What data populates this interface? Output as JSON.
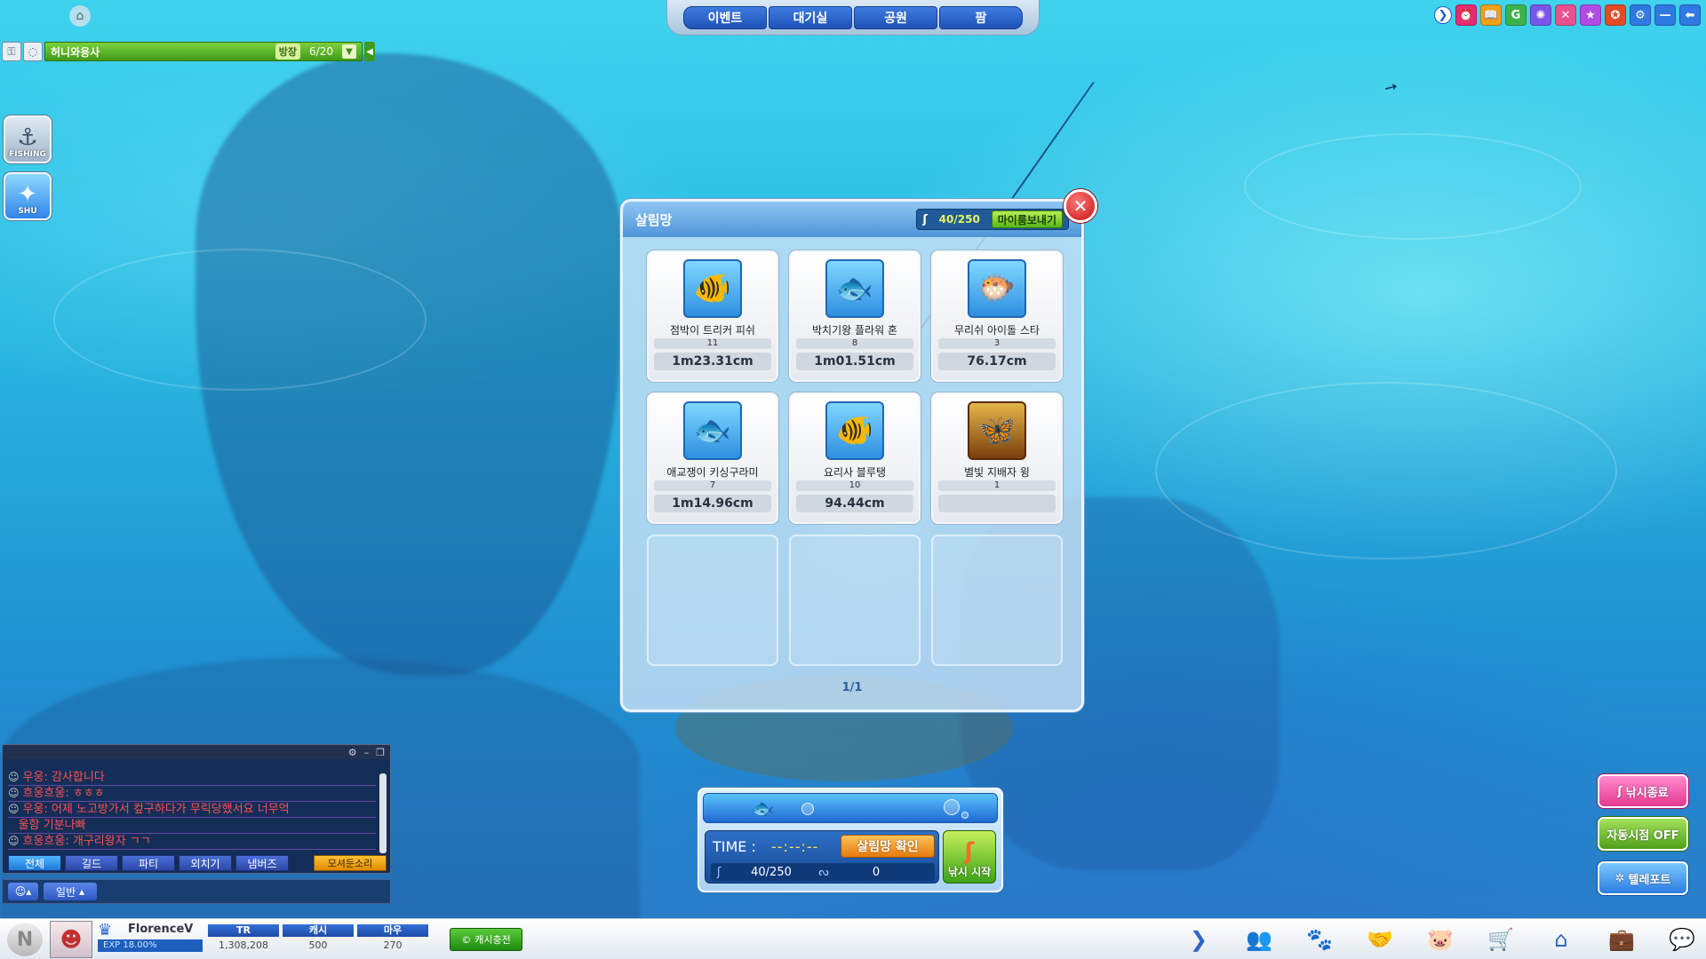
{
  "top_nav": {
    "tabs": [
      {
        "label": "이벤트"
      },
      {
        "label": "대기실"
      },
      {
        "label": "공원"
      },
      {
        "label": "팜"
      }
    ]
  },
  "top_icons": [
    {
      "icon": "arrow-right-icon",
      "glyph": "❯",
      "color": "#ffffff"
    },
    {
      "icon": "alarm-icon",
      "glyph": "⏰",
      "color": "#e52a73"
    },
    {
      "icon": "story-book-icon",
      "glyph": "📖",
      "color": "#f0a11c"
    },
    {
      "icon": "g-coin-icon",
      "glyph": "G",
      "color": "#3bb34a"
    },
    {
      "icon": "settings-star-icon",
      "glyph": "✺",
      "color": "#7b56e8"
    },
    {
      "icon": "crossed-tools-icon",
      "glyph": "✕",
      "color": "#e8508e"
    },
    {
      "icon": "event-star-icon",
      "glyph": "★",
      "color": "#b04be6"
    },
    {
      "icon": "book-icon",
      "glyph": "✪",
      "color": "#e24b25"
    },
    {
      "icon": "gear-icon",
      "glyph": "⚙",
      "color": "#2f79e3"
    },
    {
      "icon": "minimize-icon",
      "glyph": "—",
      "color": "#2f79e3"
    },
    {
      "icon": "back-arrow-icon",
      "glyph": "⬅",
      "color": "#2f79e3"
    }
  ],
  "room": {
    "name": "허니와용사",
    "owner_chip": "방장",
    "count": "6/20"
  },
  "side_buttons": [
    {
      "label": "FISHING"
    },
    {
      "label": "SHU"
    }
  ],
  "keep_net": {
    "title": "살림망",
    "capacity": "40/250",
    "send_button": "마이룸보내기",
    "page": "1/1",
    "items": [
      {
        "name": "점박이 트리커 피쉬",
        "qty": "11",
        "size": "1m23.31cm",
        "icon": "🐠",
        "gold": false
      },
      {
        "name": "박치기왕 플라워 혼",
        "qty": "8",
        "size": "1m01.51cm",
        "icon": "🐟",
        "gold": false
      },
      {
        "name": "무리쉬 아이돌 스타",
        "qty": "3",
        "size": "76.17cm",
        "icon": "🐡",
        "gold": false
      },
      {
        "name": "애교쟁이 키싱구라미",
        "qty": "7",
        "size": "1m14.96cm",
        "icon": "🐟",
        "gold": false
      },
      {
        "name": "요리사 블루탱",
        "qty": "10",
        "size": "94.44cm",
        "icon": "🐠",
        "gold": false
      },
      {
        "name": "별빛 지배자 윙",
        "qty": "1",
        "size": "",
        "icon": "🦋",
        "gold": true
      }
    ]
  },
  "fishing": {
    "time_label": "TIME :",
    "time_value": "--:--:--",
    "confirm_button": "살림망 확인",
    "catch_count": "40/250",
    "hook_count": "0",
    "start_button": "낚시 시작"
  },
  "right_buttons": [
    {
      "label": "낚시종료"
    },
    {
      "label": "자동시점 OFF"
    },
    {
      "label": "텔레포트"
    }
  ],
  "chat": {
    "lines": [
      {
        "text": "우웅: 감사합니다"
      },
      {
        "text": "흐웅흐웅: ㅎㅎㅎ"
      },
      {
        "text": "우웅: 어제 노고방가서 컾구하다가 무릭당했서요 너무억"
      },
      {
        "text": "울함 기분나빠"
      },
      {
        "text": "흐웅흐웅: 개구리왕자 ㄱㄱ"
      }
    ],
    "tabs": [
      {
        "label": "전체"
      },
      {
        "label": "길드"
      },
      {
        "label": "파티"
      },
      {
        "label": "외치기"
      },
      {
        "label": "냄버즈"
      }
    ],
    "report_button": "모셔둔소리",
    "mode": "일반"
  },
  "status": {
    "player_name": "FlorenceV",
    "exp": "EXP 18.00%",
    "currencies": [
      {
        "label": "TR",
        "value": "1,308,208"
      },
      {
        "label": "캐시",
        "value": "500"
      },
      {
        "label": "마우",
        "value": "270"
      }
    ],
    "cash_charge": "캐시충전"
  },
  "bottom_menu": [
    {
      "icon": "arrow-right-icon",
      "glyph": "❯"
    },
    {
      "icon": "friends-icon",
      "glyph": "👥"
    },
    {
      "icon": "paw-icon",
      "glyph": "🐾"
    },
    {
      "icon": "handshake-icon",
      "glyph": "🤝"
    },
    {
      "icon": "piggy-bank-icon",
      "glyph": "🐷"
    },
    {
      "icon": "cart-icon",
      "glyph": "🛒"
    },
    {
      "icon": "home-icon",
      "glyph": "⌂"
    },
    {
      "icon": "briefcase-icon",
      "glyph": "💼"
    },
    {
      "icon": "chat-bubbles-icon",
      "glyph": "💬"
    }
  ]
}
